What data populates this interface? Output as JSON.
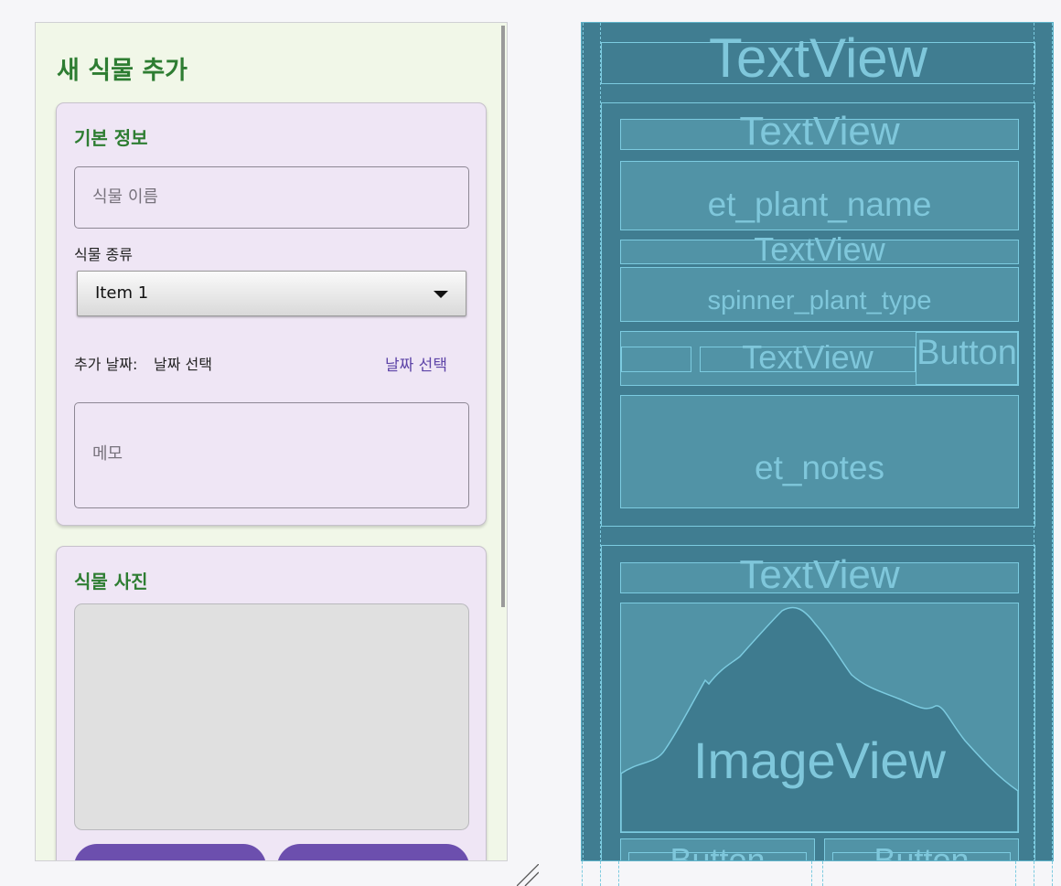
{
  "design": {
    "title": "새 식물 추가",
    "basic_card": {
      "title": "기본 정보",
      "plant_name_placeholder": "식물 이름",
      "plant_type_label": "식물 종류",
      "spinner_value": "Item 1",
      "date_label": "추가 날짜:",
      "date_value": "날짜 선택",
      "date_button": "날짜 선택",
      "notes_placeholder": "메모"
    },
    "photo_card": {
      "title": "식물 사진"
    }
  },
  "blueprint": {
    "title_view": "TextView",
    "card1_title": "TextView",
    "plant_name": "et_plant_name",
    "type_label": "TextView",
    "spinner": "spinner_plant_type",
    "date_text": "TextView",
    "date_button": "Button",
    "notes": "et_notes",
    "card2_title": "TextView",
    "image": "ImageView",
    "button1": "Button",
    "button2": "Button"
  },
  "colors": {
    "title_green": "#2e7d32",
    "card_bg": "#efe6f5",
    "button_purple": "#6c4fae",
    "link_purple": "#5e45a8",
    "blueprint_bg": "#407d91",
    "blueprint_line": "#7ccbe0"
  }
}
